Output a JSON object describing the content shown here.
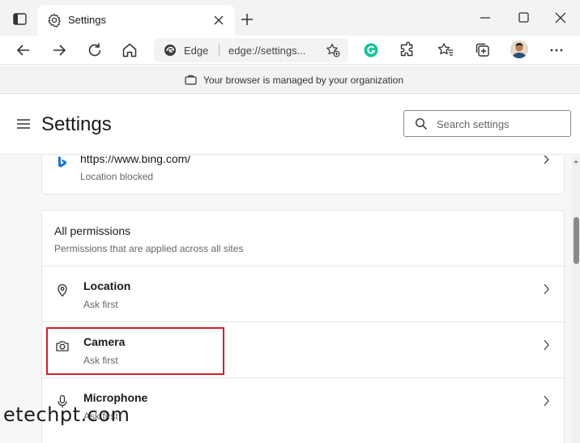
{
  "tab": {
    "title": "Settings"
  },
  "addressbar": {
    "identity": "Edge",
    "url": "edge://settings..."
  },
  "banner": {
    "text": "Your browser is managed by your organization"
  },
  "header": {
    "title": "Settings",
    "search_placeholder": "Search settings"
  },
  "site_entry": {
    "url": "https://www.bing.com/",
    "status": "Location blocked"
  },
  "permissions": {
    "title": "All permissions",
    "subtitle": "Permissions that are applied across all sites",
    "items": [
      {
        "label": "Location",
        "value": "Ask first",
        "icon": "location-pin-icon"
      },
      {
        "label": "Camera",
        "value": "Ask first",
        "icon": "camera-icon"
      },
      {
        "label": "Microphone",
        "value": "Ask first",
        "icon": "microphone-icon"
      }
    ]
  },
  "watermark": "etechpt.com",
  "colors": {
    "highlight": "#d1202a",
    "grammarly": "#15c39a",
    "bing": "#1e73d8"
  }
}
